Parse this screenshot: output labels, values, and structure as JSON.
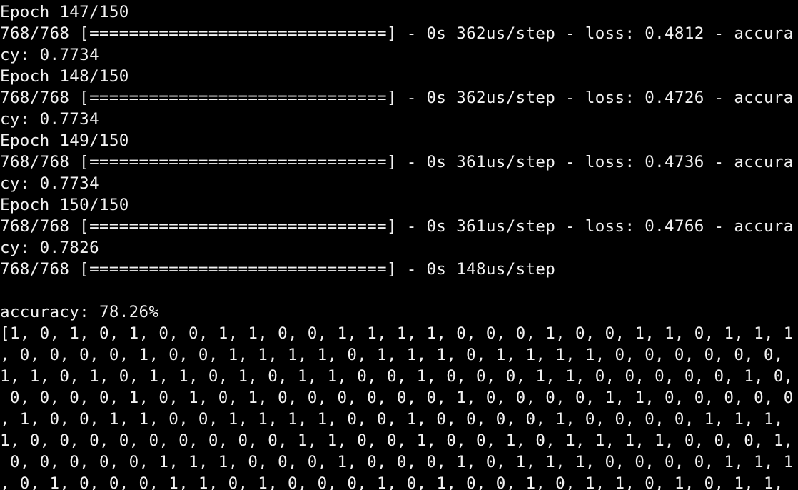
{
  "terminal": {
    "background": "#000000",
    "foreground": "#f2f2f2",
    "lines": [
      "Epoch 147/150",
      "768/768 [==============================] - 0s 362us/step - loss: 0.4812 - accura",
      "cy: 0.7734",
      "Epoch 148/150",
      "768/768 [==============================] - 0s 362us/step - loss: 0.4726 - accura",
      "cy: 0.7734",
      "Epoch 149/150",
      "768/768 [==============================] - 0s 361us/step - loss: 0.4736 - accura",
      "cy: 0.7734",
      "Epoch 150/150",
      "768/768 [==============================] - 0s 361us/step - loss: 0.4766 - accura",
      "cy: 0.7826",
      "768/768 [==============================] - 0s 148us/step",
      "",
      "accuracy: 78.26%",
      "[1, 0, 1, 0, 1, 0, 0, 1, 1, 0, 0, 1, 1, 1, 1, 0, 0, 0, 1, 0, 0, 1, 1, 0, 1, 1, 1",
      ", 0, 0, 0, 0, 1, 0, 0, 1, 1, 1, 1, 0, 1, 1, 1, 0, 1, 1, 1, 1, 0, 0, 0, 0, 0, 0,",
      "1, 1, 0, 1, 0, 1, 1, 0, 1, 0, 1, 1, 0, 0, 1, 0, 0, 0, 1, 1, 0, 0, 0, 0, 0, 1, 0,",
      " 0, 0, 0, 0, 1, 0, 1, 0, 1, 0, 0, 0, 0, 0, 0, 1, 0, 0, 0, 0, 1, 1, 0, 0, 0, 0, 0",
      ", 1, 0, 0, 1, 1, 0, 0, 1, 1, 1, 1, 0, 0, 1, 0, 0, 0, 0, 1, 0, 0, 0, 0, 1, 1, 1,",
      "1, 0, 0, 0, 0, 0, 0, 0, 0, 0, 1, 1, 0, 0, 1, 0, 0, 1, 0, 1, 1, 1, 1, 0, 0, 0, 1,",
      " 0, 0, 0, 0, 0, 1, 1, 1, 0, 0, 0, 1, 0, 0, 0, 1, 0, 1, 1, 1, 0, 0, 0, 0, 1, 1, 1",
      ", 0, 1, 0, 0, 0, 1, 1, 0, 1, 0, 0, 0, 1, 0, 1, 0, 0, 1, 0, 1, 1, 0, 1, 0, 1, 1,"
    ]
  }
}
